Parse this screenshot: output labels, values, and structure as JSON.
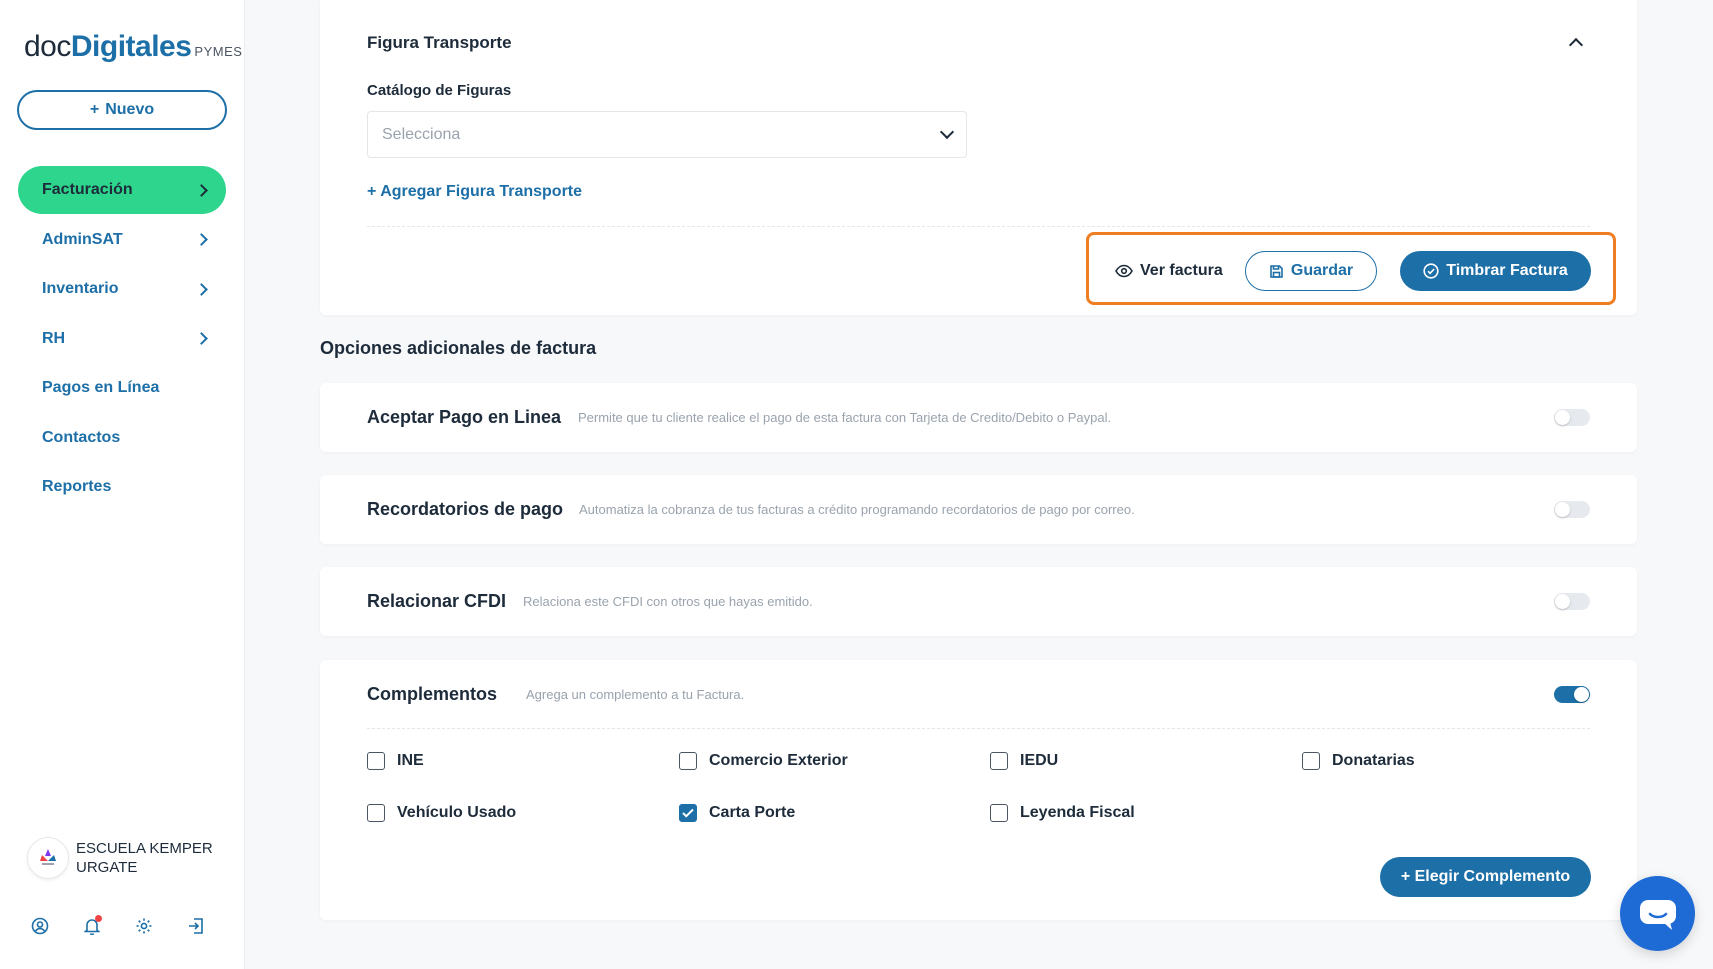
{
  "brand": {
    "doc": "doc",
    "digitales": "Digitales",
    "pymes": "PYMES"
  },
  "sidebar": {
    "new_label": "Nuevo",
    "items": [
      {
        "label": "Facturación",
        "chevron": true,
        "active": true
      },
      {
        "label": "AdminSAT",
        "chevron": true
      },
      {
        "label": "Inventario",
        "chevron": true
      },
      {
        "label": "RH",
        "chevron": true
      },
      {
        "label": "Pagos en Línea",
        "chevron": false
      },
      {
        "label": "Contactos",
        "chevron": false
      },
      {
        "label": "Reportes",
        "chevron": false
      }
    ],
    "user_name": "ESCUELA KEMPER URGATE",
    "bottom_icons": [
      "user-circle-icon",
      "bell-icon",
      "gear-icon",
      "logout-icon"
    ]
  },
  "figura": {
    "title": "Figura Transporte",
    "catalog_label": "Catálogo de Figuras",
    "select_placeholder": "Selecciona",
    "add_link": "+ Agregar Figura Transporte"
  },
  "actions": {
    "ver": "Ver factura",
    "guardar": "Guardar",
    "timbrar": "Timbrar Factura"
  },
  "opciones": {
    "title": "Opciones adicionales de factura",
    "items": [
      {
        "title": "Aceptar Pago en Linea",
        "desc": "Permite que tu cliente realice el pago de esta factura con Tarjeta de Credito/Debito o Paypal.",
        "on": false
      },
      {
        "title": "Recordatorios de pago",
        "desc": "Automatiza la cobranza de tus facturas a crédito programando recordatorios de pago por correo.",
        "on": false
      },
      {
        "title": "Relacionar CFDI",
        "desc": "Relaciona este CFDI con otros que hayas emitido.",
        "on": false
      }
    ]
  },
  "complementos": {
    "title": "Complementos",
    "desc": "Agrega un complemento a tu Factura.",
    "on": true,
    "items": [
      {
        "label": "INE",
        "checked": false
      },
      {
        "label": "Comercio Exterior",
        "checked": false
      },
      {
        "label": "IEDU",
        "checked": false
      },
      {
        "label": "Donatarias",
        "checked": false
      },
      {
        "label": "Vehículo Usado",
        "checked": false
      },
      {
        "label": "Carta Porte",
        "checked": true
      },
      {
        "label": "Leyenda Fiscal",
        "checked": false
      }
    ],
    "elegir": "+ Elegir Complemento"
  },
  "colors": {
    "primary": "#1d6fa7",
    "active_nav": "#2dd68c",
    "highlight_box": "#ef7d22",
    "chat": "#1e6bd6"
  }
}
